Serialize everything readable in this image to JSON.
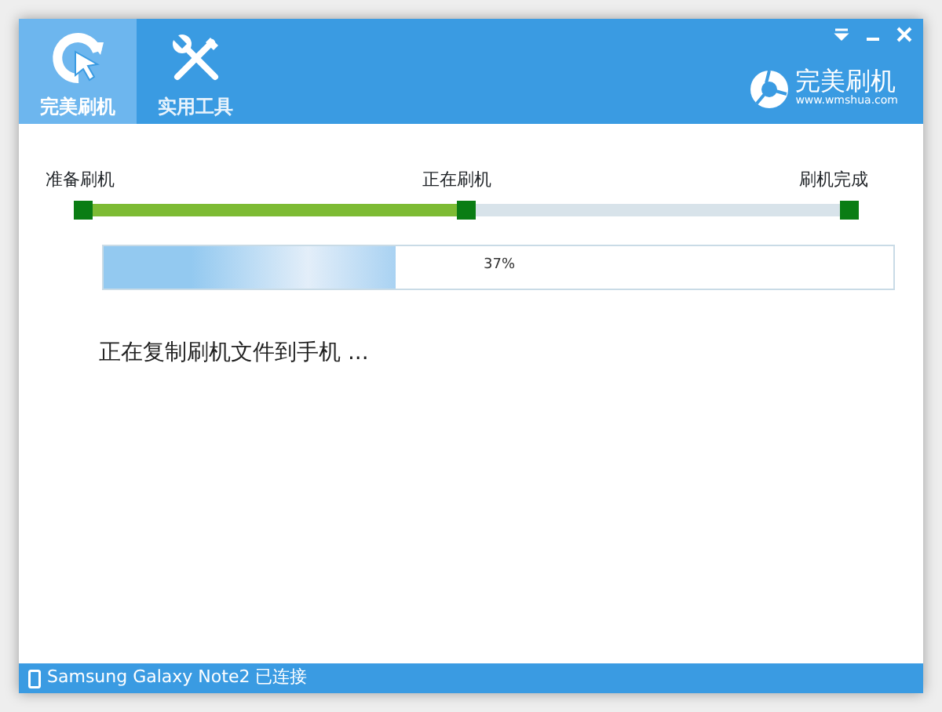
{
  "tabs": [
    {
      "label": "完美刷机",
      "selected": true
    },
    {
      "label": "实用工具",
      "selected": false
    }
  ],
  "brand": {
    "name": "完美刷机",
    "url": "www.wmshua.com"
  },
  "steps": {
    "level": 0.5,
    "items": [
      {
        "label": "准备刷机"
      },
      {
        "label": "正在刷机"
      },
      {
        "label": "刷机完成"
      }
    ]
  },
  "progress": {
    "level": 0.37,
    "reading": "37%"
  },
  "message": "正在复制刷机文件到手机 ...",
  "status_bar": {
    "device": "Samsung Galaxy Note2 已连接"
  }
}
